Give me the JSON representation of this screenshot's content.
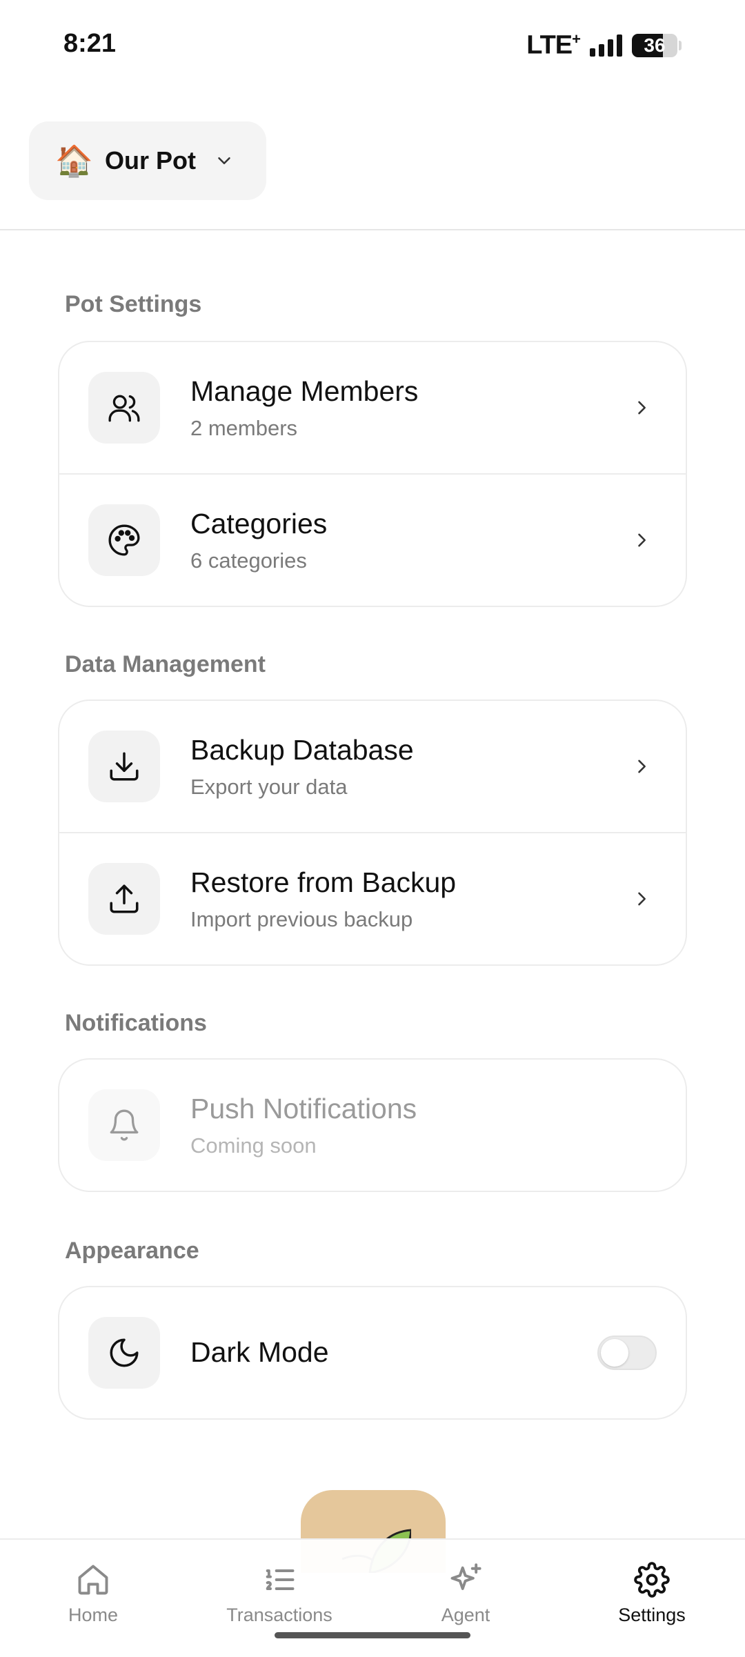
{
  "status_bar": {
    "time": "8:21",
    "network": "LTE",
    "network_suffix": "+",
    "battery": "36"
  },
  "pot_selector": {
    "emoji": "🏠",
    "name": "Our Pot"
  },
  "sections": {
    "pot_settings": {
      "title": "Pot Settings",
      "items": [
        {
          "title": "Manage Members",
          "subtitle": "2 members",
          "icon": "users-icon"
        },
        {
          "title": "Categories",
          "subtitle": "6 categories",
          "icon": "palette-icon"
        }
      ]
    },
    "data_management": {
      "title": "Data Management",
      "items": [
        {
          "title": "Backup Database",
          "subtitle": "Export your data",
          "icon": "download-icon"
        },
        {
          "title": "Restore from Backup",
          "subtitle": "Import previous backup",
          "icon": "upload-icon"
        }
      ]
    },
    "notifications": {
      "title": "Notifications",
      "items": [
        {
          "title": "Push Notifications",
          "subtitle": "Coming soon",
          "icon": "bell-icon",
          "disabled": true
        }
      ]
    },
    "appearance": {
      "title": "Appearance",
      "items": [
        {
          "title": "Dark Mode",
          "icon": "moon-icon",
          "toggle_on": false
        }
      ]
    }
  },
  "nav": [
    {
      "label": "Home",
      "icon": "home-icon",
      "active": false
    },
    {
      "label": "Transactions",
      "icon": "list-ordered-icon",
      "active": false
    },
    {
      "label": "Agent",
      "icon": "sparkles-icon",
      "active": false
    },
    {
      "label": "Settings",
      "icon": "gear-icon",
      "active": true
    }
  ]
}
